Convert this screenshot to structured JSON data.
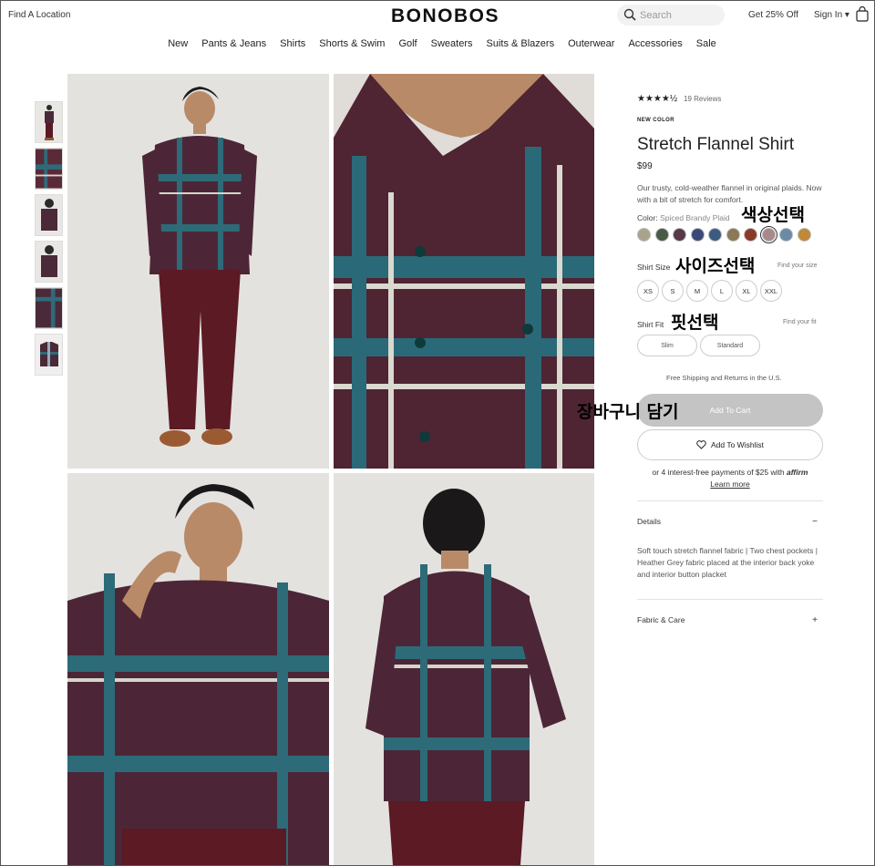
{
  "header": {
    "find_location": "Find A Location",
    "logo": "BONOBOS",
    "search_placeholder": "Search",
    "promo": "Get 25% Off",
    "sign_in": "Sign In ▾"
  },
  "nav": [
    "New",
    "Pants & Jeans",
    "Shirts",
    "Shorts & Swim",
    "Golf",
    "Sweaters",
    "Suits & Blazers",
    "Outerwear",
    "Accessories",
    "Sale"
  ],
  "product": {
    "stars": "★★★★½",
    "reviews": "19 Reviews",
    "badge": "NEW COLOR",
    "title": "Stretch Flannel Shirt",
    "price": "$99",
    "description": "Our trusty, cold-weather flannel in original plaids. Now with a bit of stretch for comfort.",
    "color_label": "Color:",
    "color_value": "Spiced Brandy Plaid",
    "swatch_colors": [
      "#a8a48c",
      "#4a5a48",
      "#5a3848",
      "#3a4a78",
      "#3a5a80",
      "#8a7858",
      "#8a3a28",
      "#a88888",
      "#6a8aa8",
      "#c08838"
    ],
    "selected_swatch_index": 7,
    "size_label": "Shirt Size",
    "find_size": "Find your size",
    "sizes": [
      "XS",
      "S",
      "M",
      "L",
      "XL",
      "XXL"
    ],
    "fit_label": "Shirt Fit",
    "find_fit": "Find your fit",
    "fits": [
      "Slim",
      "Standard"
    ],
    "shipping": "Free Shipping and Returns in the U.S.",
    "add_to_cart": "Add To Cart",
    "add_to_wishlist": "Add To Wishlist",
    "affirm_text": "or 4 interest-free payments of $25 with",
    "affirm_brand": "affirm",
    "affirm_learn": "Learn more",
    "details_label": "Details",
    "details_sign": "−",
    "details_text": "Soft touch stretch flannel fabric | Two chest pockets | Heather Grey fabric placed at the interior back yoke and interior button placket",
    "fabric_label": "Fabric & Care",
    "fabric_sign": "+"
  },
  "annotations": {
    "color_select": "색상선택",
    "size_select": "사이즈선택",
    "fit_select": "핏선택",
    "add_cart": "장바구니 담기"
  }
}
